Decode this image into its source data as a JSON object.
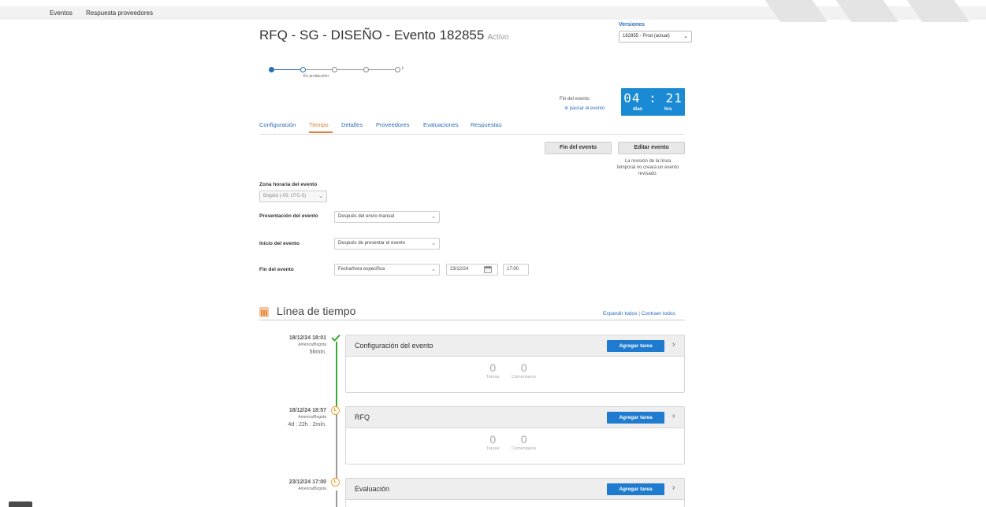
{
  "topnav": {
    "events": "Eventos",
    "responses": "Respuesta proveedores"
  },
  "header": {
    "title": "RFQ - SG - DISEÑO - Evento 182855",
    "status": "Activo"
  },
  "versions": {
    "label": "Versiones",
    "selected": "182855 - Prod (actual)"
  },
  "stepper": {
    "current_label": "En producción",
    "steps_total": 5,
    "current_step": 2
  },
  "countdown": {
    "end_label": "Fin del evento",
    "pause_link": "pausar el evento",
    "digits": "04 : 21",
    "unit_days": "días",
    "unit_hours": "hrs"
  },
  "tabs": [
    {
      "label": "Configuración"
    },
    {
      "label": "Tiempo",
      "active": true
    },
    {
      "label": "Detalles"
    },
    {
      "label": "Proveedores"
    },
    {
      "label": "Evaluaciones"
    },
    {
      "label": "Respuestas"
    }
  ],
  "actions": {
    "end_event": "Fin del evento",
    "edit_event": "Editar evento",
    "note": "La revisión de la línea temporal no creará un evento revisado."
  },
  "form": {
    "timezone_label": "Zona horaria del evento",
    "timezone_value": "Bogotá (-05; UTC-5)",
    "presentation_label": "Presentación del evento",
    "presentation_value": "Después del envío manual",
    "start_label": "Inicio del evento",
    "start_value": "Después de presentar el evento",
    "end_label": "Fin del evento",
    "end_value": "Fecha/hora específica",
    "end_date": "23/12/24",
    "end_time": "17:00"
  },
  "timeline": {
    "title": "Línea de tiempo",
    "expand_all": "Expandir todos",
    "separator": "|",
    "collapse_all": "Contraer todos",
    "add_task": "Agregar tarea",
    "tasks_label": "Tareas",
    "comments_label": "Comentarios",
    "stages": [
      {
        "date": "18/12/24 18:01",
        "tz": "America/Bogota",
        "duration": "56mín.",
        "title": "Configuración del evento",
        "tasks": "0",
        "comments": "0",
        "status": "done"
      },
      {
        "date": "18/12/24 18:57",
        "tz": "America/Bogota",
        "duration": "4d : 22h : 2mín.",
        "title": "RFQ",
        "tasks": "0",
        "comments": "0",
        "status": "active"
      },
      {
        "date": "23/12/24 17:00",
        "tz": "America/Bogota",
        "duration": "",
        "title": "Evaluación",
        "tasks": "",
        "comments": "",
        "status": "pending"
      }
    ]
  },
  "colors": {
    "link": "#2a6ebb",
    "accent_tab": "#e07b39",
    "timer_bg": "#1a8ad4",
    "button_primary": "#1f7bd0",
    "done": "#3aaa35",
    "pending": "#f0a030"
  }
}
